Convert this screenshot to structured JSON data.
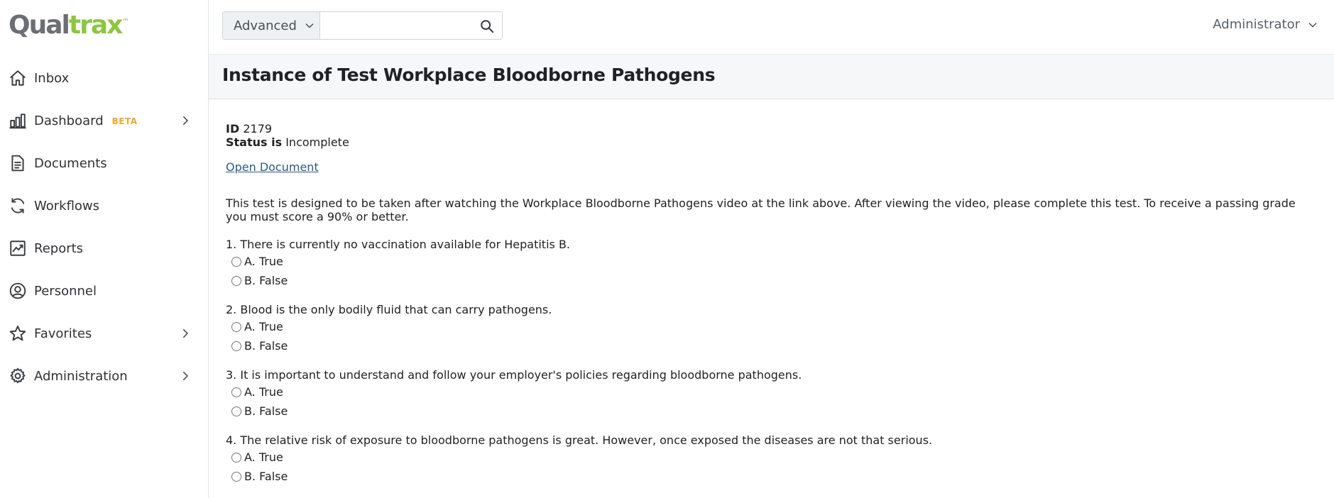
{
  "logo": {
    "prefix": "Qual",
    "accent": "trax",
    "tm": "™"
  },
  "sidebar": {
    "items": [
      {
        "label": "Inbox",
        "icon": "home-icon"
      },
      {
        "label": "Dashboard",
        "badge": "BETA",
        "icon": "bar-chart-icon",
        "has_submenu": true
      },
      {
        "label": "Documents",
        "icon": "document-icon"
      },
      {
        "label": "Workflows",
        "icon": "refresh-icon"
      },
      {
        "label": "Reports",
        "icon": "trending-chart-icon"
      },
      {
        "label": "Personnel",
        "icon": "user-circle-icon"
      },
      {
        "label": "Favorites",
        "icon": "star-icon",
        "has_submenu": true
      },
      {
        "label": "Administration",
        "icon": "gear-icon",
        "has_submenu": true
      }
    ]
  },
  "topbar": {
    "search_mode": "Advanced",
    "search_placeholder": "",
    "user_label": "Administrator"
  },
  "page": {
    "title": "Instance of Test Workplace Bloodborne Pathogens"
  },
  "record": {
    "id_label": "ID",
    "id_value": "2179",
    "status_label": "Status is",
    "status_value": "Incomplete",
    "open_document": "Open Document",
    "intro": "This test is designed to be taken after watching the Workplace Bloodborne Pathogens video at the link above. After viewing the video, please complete this test. To receive a passing grade you must score a 90% or better."
  },
  "questions": [
    {
      "text": "1. There is currently no vaccination available for Hepatitis B.",
      "options": [
        "A. True",
        "B. False"
      ]
    },
    {
      "text": "2. Blood is the only bodily fluid that can carry pathogens.",
      "options": [
        "A. True",
        "B. False"
      ]
    },
    {
      "text": "3. It is important to understand and follow your employer's policies regarding bloodborne pathogens.",
      "options": [
        "A. True",
        "B. False"
      ]
    },
    {
      "text": "4. The relative risk of exposure to bloodborne pathogens is great. However, once exposed the diseases are not that serious.",
      "options": [
        "A. True",
        "B. False"
      ]
    }
  ],
  "colors": {
    "logo_accent": "#8cc63f",
    "beta": "#f0a92c",
    "link": "#2a5a8a"
  }
}
